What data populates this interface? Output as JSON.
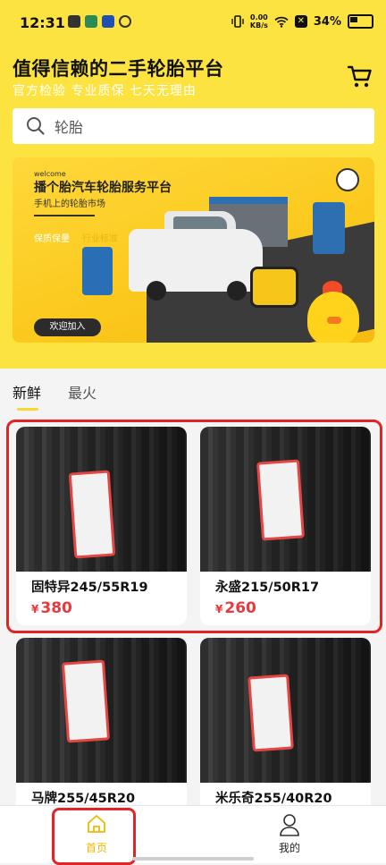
{
  "status_bar": {
    "time": "12:31",
    "net_speed_value": "0.00",
    "net_speed_unit": "KB/s",
    "battery": "34%"
  },
  "header": {
    "title": "值得信赖的二手轮胎平台",
    "subtitle": "官方检验 专业质保 七天无理由",
    "cart_icon": "shopping-cart-icon"
  },
  "search": {
    "placeholder": "轮胎",
    "icon": "search-icon"
  },
  "banner": {
    "welcome": "welcome",
    "title": "播个胎汽车轮胎服务平台",
    "subtitle": "手机上的轮胎市场",
    "tag1": "保质保量",
    "tag2": "行业标准",
    "button": "欢迎加入"
  },
  "tabs": [
    {
      "label": "新鲜",
      "active": true
    },
    {
      "label": "最火",
      "active": false
    }
  ],
  "products": [
    {
      "name": "固特异245/55R19",
      "currency": "¥",
      "price": "380"
    },
    {
      "name": "永盛215/50R17",
      "currency": "¥",
      "price": "260"
    },
    {
      "name": "马牌255/45R20"
    },
    {
      "name": "米乐奇255/40R20"
    }
  ],
  "bottom_nav": [
    {
      "label": "首页",
      "icon": "home-icon",
      "active": true
    },
    {
      "label": "我的",
      "icon": "user-icon",
      "active": false
    }
  ],
  "colors": {
    "brand_yellow": "#fde340",
    "price_red": "#e8393c",
    "nav_active": "#f0b800",
    "highlight_red": "#e12424"
  }
}
